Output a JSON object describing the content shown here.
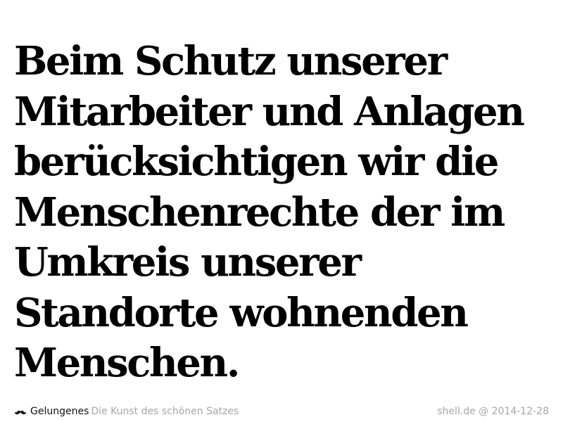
{
  "quote": {
    "lines": [
      "Beim Schutz unserer",
      "Mitarbeiter und Anlagen",
      "berücksichtigen wir die",
      "Menschenrechte der im",
      "Umkreis unserer",
      "Standorte wohnenden",
      "Menschen."
    ]
  },
  "footer": {
    "icon": "mustache-icon",
    "brand": "Gelungenes",
    "tagline": "Die Kunst des schönen Satzes",
    "source": "shell.de @ 2014-12-28"
  },
  "colors": {
    "text": "#000000",
    "muted": "#a6a6a6"
  }
}
